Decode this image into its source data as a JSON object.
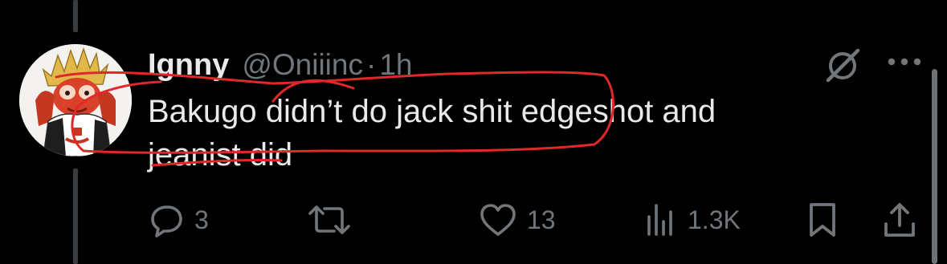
{
  "tweet": {
    "author": {
      "display_name": "Ignny",
      "handle": "@Oniiinc",
      "separator": "·",
      "time": "1h"
    },
    "text": "Bakugo didn’t do jack shit edgeshot and\njeanist did"
  },
  "actions": {
    "reply_count": "3",
    "like_count": "13",
    "views_count": "1.3K"
  },
  "icons": {
    "avatar": "avatar-image",
    "grok": "grok-icon",
    "more": "more-icon",
    "reply": "reply-icon",
    "retweet": "retweet-icon",
    "like": "heart-icon",
    "views": "views-icon",
    "bookmark": "bookmark-icon",
    "share": "share-icon"
  },
  "colors": {
    "background": "#000000",
    "text_primary": "#e7e9ea",
    "text_secondary": "#71767b",
    "annotation": "#e0282b"
  }
}
